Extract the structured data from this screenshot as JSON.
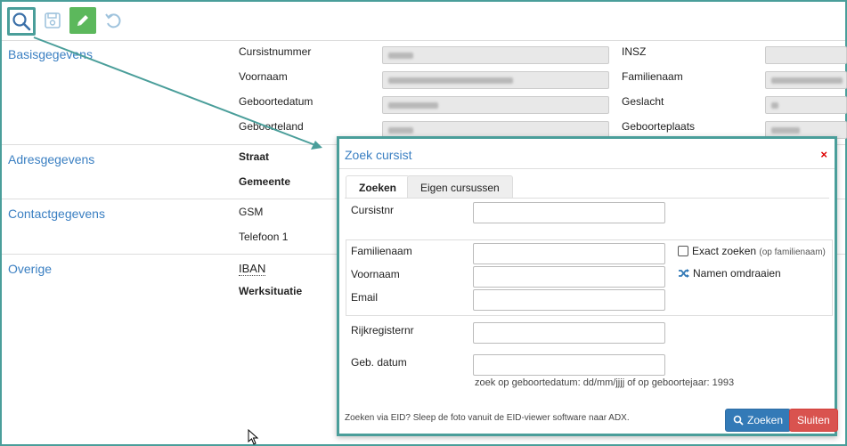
{
  "toolbar": {
    "search_icon": "search-icon",
    "save_icon": "save-icon",
    "edit_icon": "pencil-icon",
    "undo_icon": "undo-icon",
    "accent": "#4a9e9a"
  },
  "sections": {
    "basis": "Basisgegevens",
    "adres": "Adresgegevens",
    "contact": "Contactgegevens",
    "overige": "Overige"
  },
  "fields": {
    "cursistnummer": "Cursistnummer",
    "insz": "INSZ",
    "voornaam": "Voornaam",
    "familienaam": "Familienaam",
    "geboortedatum": "Geboortedatum",
    "geslacht": "Geslacht",
    "geboorteland": "Geboorteland",
    "geboorteplaats": "Geboorteplaats",
    "straat": "Straat",
    "gemeente": "Gemeente",
    "gsm": "GSM",
    "telefoon1": "Telefoon 1",
    "iban": "IBAN",
    "werksituatie": "Werksituatie"
  },
  "modal": {
    "title": "Zoek cursist",
    "close": "×",
    "tabs": [
      "Zoeken",
      "Eigen cursussen"
    ],
    "cursistnr_label": "Cursistnr",
    "familienaam_label": "Familienaam",
    "voornaam_label": "Voornaam",
    "email_label": "Email",
    "exact_zoeken": "Exact zoeken",
    "exact_note": "(op familienaam)",
    "namen_omdraaien": "Namen omdraaien",
    "rijkregisternr_label": "Rijkregisternr",
    "geb_datum_label": "Geb. datum",
    "geb_hint": "zoek op geboortedatum: dd/mm/jjjj of op geboortejaar: 1993",
    "footer": "Zoeken via EID? Sleep de foto vanuit de EID-viewer software naar ADX.",
    "search_button": "Zoeken",
    "close_button": "Sluiten",
    "primary_color": "#337ab7",
    "danger_color": "#d9534f"
  }
}
